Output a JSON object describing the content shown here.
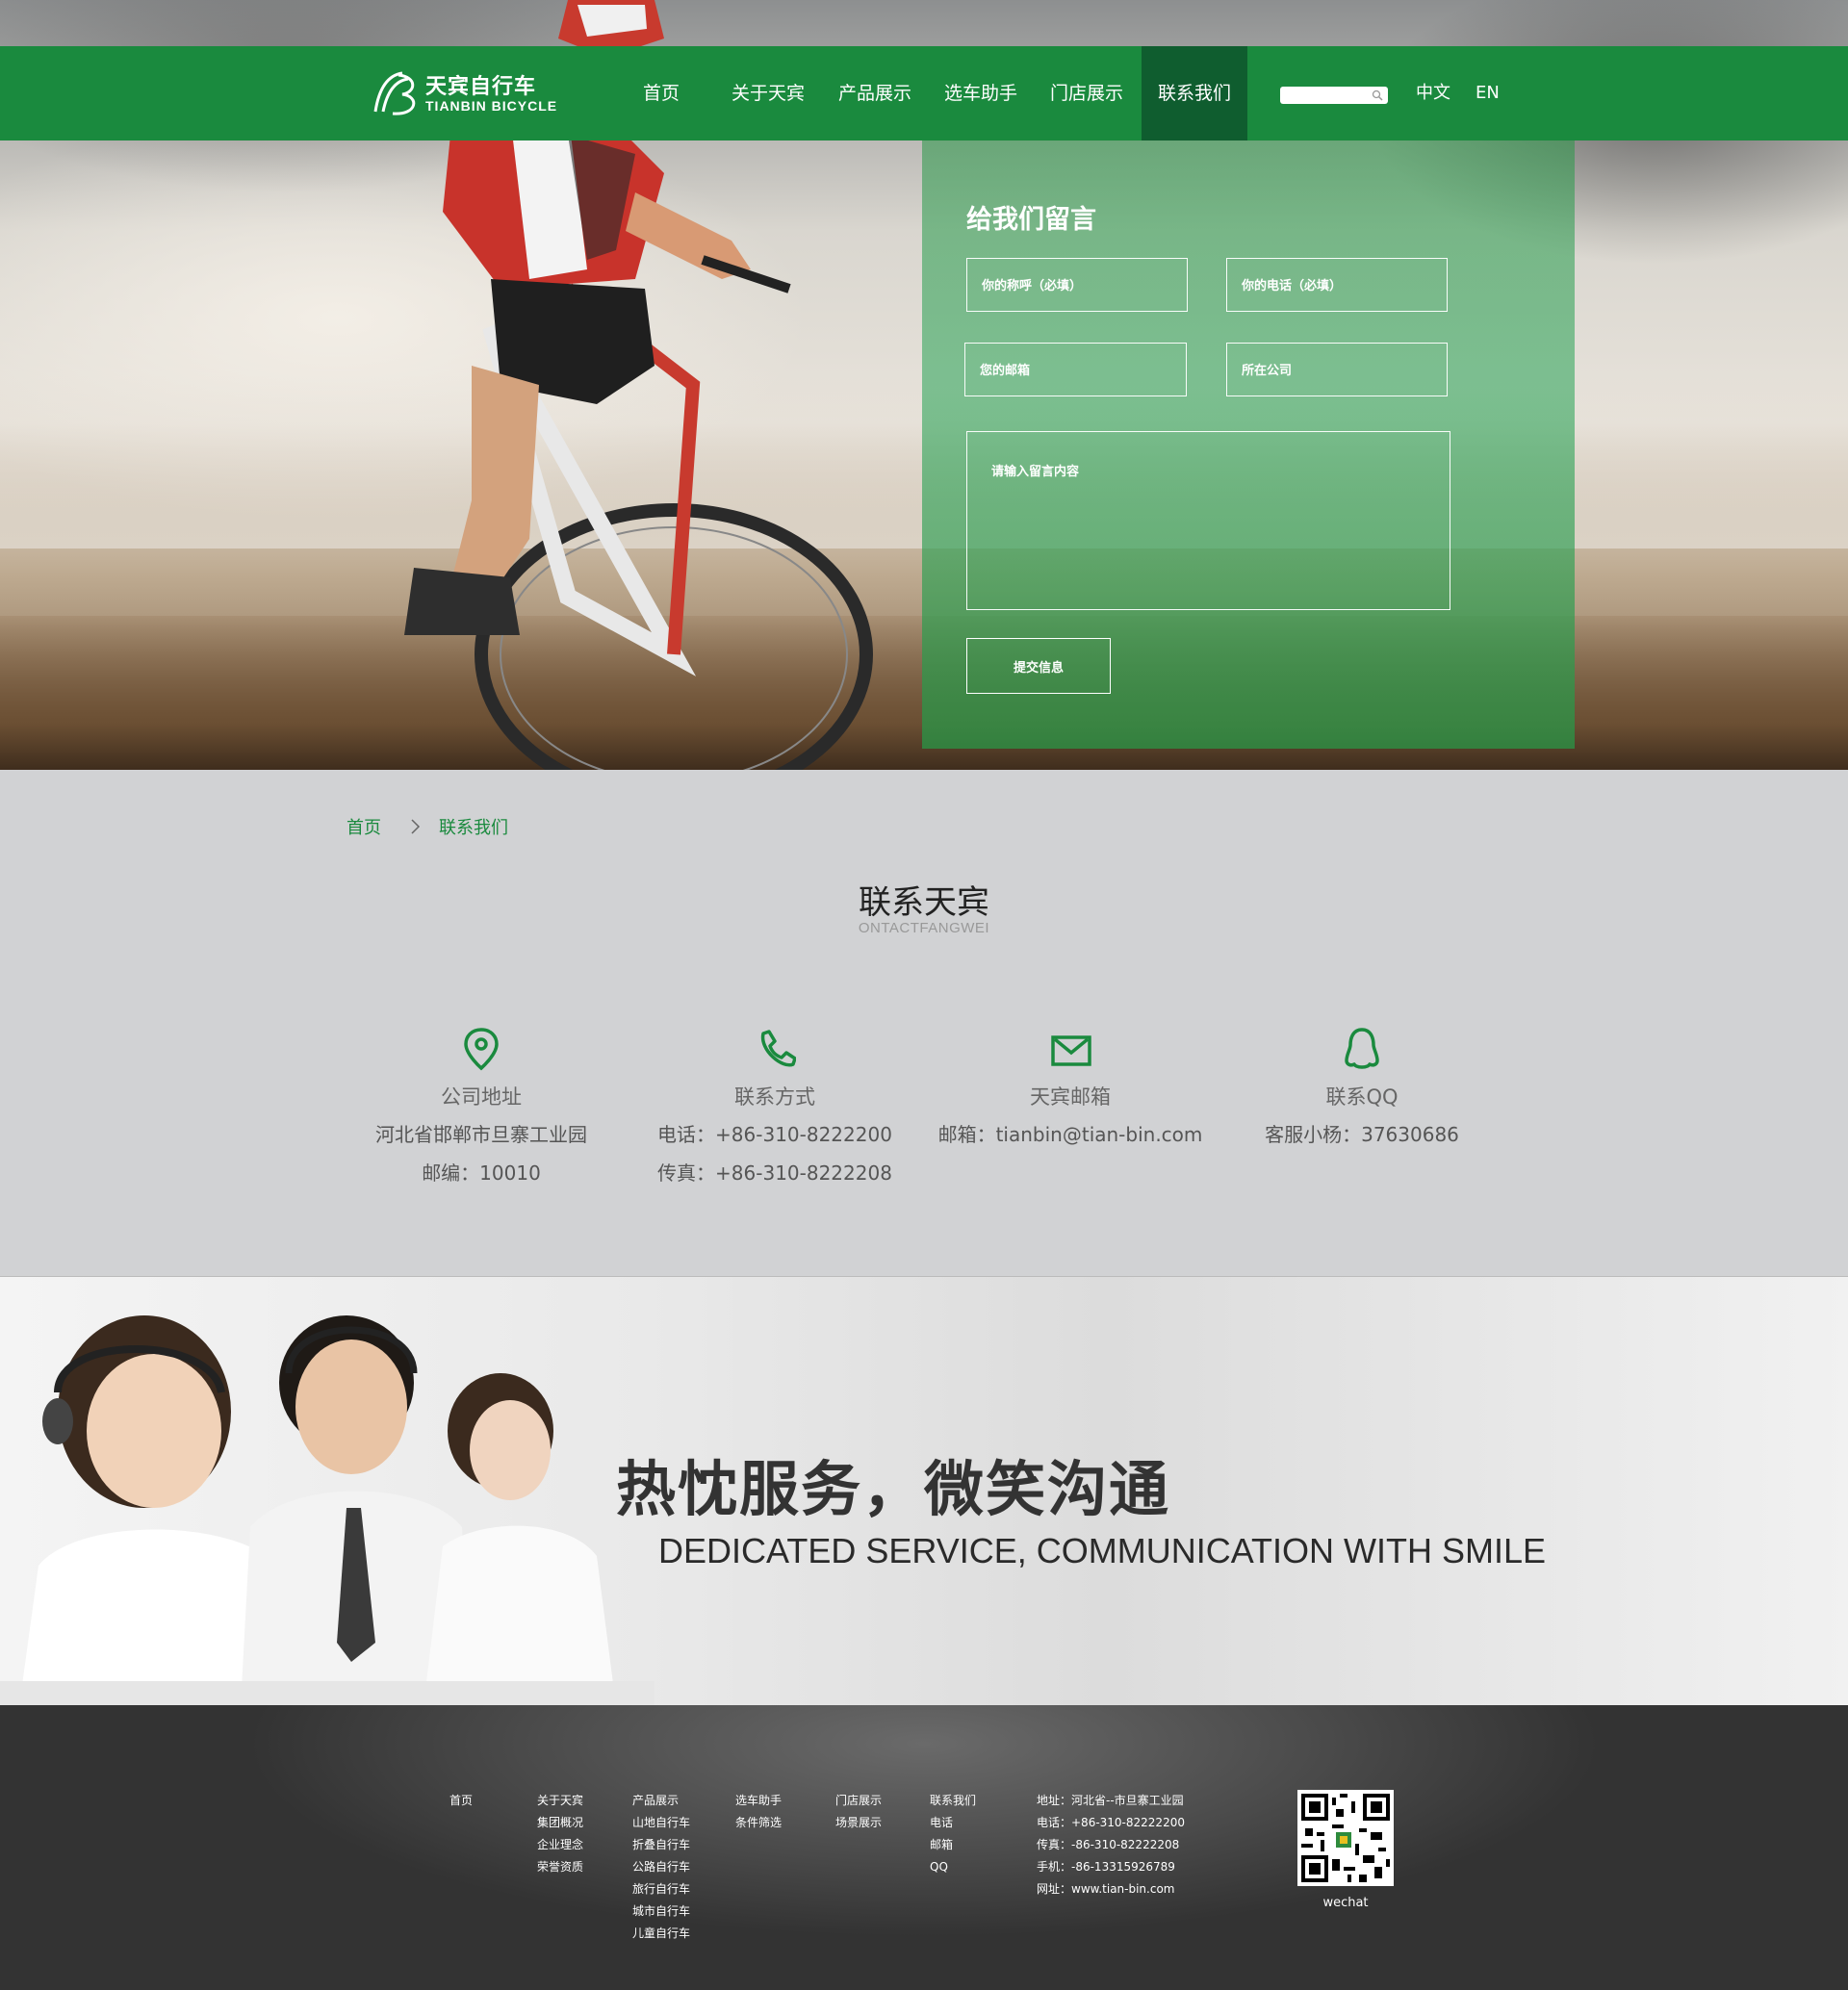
{
  "brand": {
    "name_cn": "天宾自行车",
    "name_en": "TIANBIN BICYCLE",
    "logo_mark": "TB"
  },
  "nav": {
    "items": [
      {
        "label": "首页"
      },
      {
        "label": "关于天宾"
      },
      {
        "label": "产品展示"
      },
      {
        "label": "选车助手"
      },
      {
        "label": "门店展示"
      },
      {
        "label": "联系我们"
      }
    ],
    "active": "联系我们",
    "search_placeholder": "",
    "lang_cn": "中文",
    "lang_en": "EN"
  },
  "form": {
    "title": "给我们留言",
    "name_placeholder": "你的称呼（必填）",
    "phone_placeholder": "你的电话（必填）",
    "email_placeholder": "您的邮箱",
    "company_placeholder": "所在公司",
    "message_placeholder": "请输入留言内容",
    "submit_label": "提交信息"
  },
  "breadcrumb": {
    "home": "首页",
    "current": "联系我们"
  },
  "contact": {
    "title": "联系天宾",
    "subtitle": "ONTACTFANGWEI",
    "cards": [
      {
        "icon": "location-pin-icon",
        "title": "公司地址",
        "lines": [
          "河北省邯郸市旦寨工业园",
          "邮编：10010"
        ]
      },
      {
        "icon": "phone-icon",
        "title": "联系方式",
        "lines": [
          "电话：+86-310-8222200",
          "传真：+86-310-8222208"
        ]
      },
      {
        "icon": "mail-icon",
        "title": "天宾邮箱",
        "lines": [
          "邮箱：tianbin@tian-bin.com"
        ]
      },
      {
        "icon": "qq-icon",
        "title": "联系QQ",
        "lines": [
          "客服小杨：37630686"
        ]
      }
    ]
  },
  "banner": {
    "headline_cn": "热忱服务，微笑沟通",
    "headline_en": "DEDICATED SERVICE, COMMUNICATION WITH SMILE"
  },
  "footer": {
    "columns": [
      [
        "首页"
      ],
      [
        "关于天宾",
        "集团概况",
        "企业理念",
        "荣誉资质"
      ],
      [
        "产品展示",
        "山地自行车",
        "折叠自行车",
        "公路自行车",
        "旅行自行车",
        "城市自行车",
        "儿童自行车"
      ],
      [
        "选车助手",
        "条件筛选"
      ],
      [
        "门店展示",
        "场景展示"
      ],
      [
        "联系我们",
        "电话",
        "邮箱",
        "QQ"
      ]
    ],
    "contact_lines": [
      "地址：河北省--市旦寨工业园",
      "电话：+86-310-82222200",
      "传真：-86-310-82222208",
      "手机：-86-13315926789",
      "网址：www.tian-bin.com"
    ],
    "qr_label": "wechat"
  },
  "colors": {
    "brand_green": "#1a8a3e",
    "nav_active": "#0f5d2f",
    "footer_dark": "#4a4a4a"
  }
}
